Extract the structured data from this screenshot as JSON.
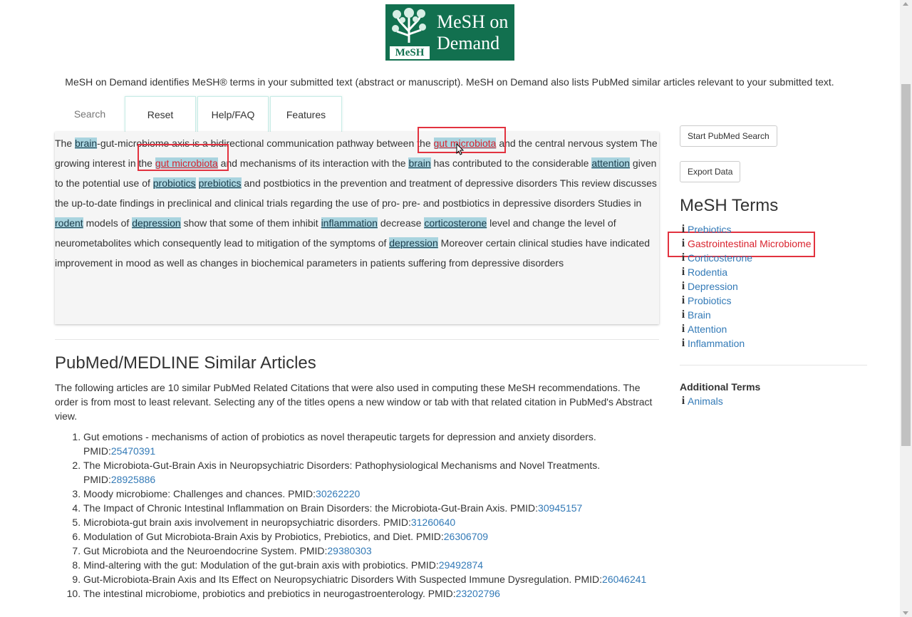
{
  "logo": {
    "line1": "MeSH on",
    "line2": "Demand",
    "tag": "MeSH"
  },
  "intro": "MeSH on Demand identifies MeSH® terms in your submitted text (abstract or manuscript). MeSH on Demand also lists PubMed similar articles relevant to your submitted text.",
  "tabs": {
    "search": "Search",
    "reset": "Reset",
    "help": "Help/FAQ",
    "features": "Features"
  },
  "text": {
    "t0": "The ",
    "h_brain1": "brain",
    "t1": "-gut-microbiome axis is a bidirectional communication pathway between the ",
    "h_gut1": "gut microbiota",
    "t2": " and the central nervous system The growing interest in the ",
    "h_gut2": "gut microbiota",
    "t3": " and mechanisms of its interaction with the ",
    "h_brain2": "brain",
    "t4": " has contributed to the considerable ",
    "h_attention": "attention",
    "t5": " given to the potential use of ",
    "h_probiotics": "probiotics",
    "t6": " ",
    "h_prebiotics": "prebiotics",
    "t7": " and postbiotics in the prevention and treatment of depressive disorders This review discusses the up-to-date findings in preclinical and clinical trials regarding the use of pro- pre- and postbiotics in depressive disorders Studies in ",
    "h_rodent": "rodent",
    "t8": " models of ",
    "h_depression1": "depression",
    "t9": " show that some of them inhibit ",
    "h_inflammation": "inflammation",
    "t10": " decrease ",
    "h_corticosterone": "corticosterone",
    "t11": " level and change the level of neurometabolites which consequently lead to mitigation of the symptoms of ",
    "h_depression2": "depression",
    "t12": " Moreover certain clinical studies have indicated improvement in mood as well as changes in biochemical parameters in patients suffering from depressive disorders"
  },
  "similar": {
    "title": "PubMed/MEDLINE Similar Articles",
    "description": "The following articles are 10 similar PubMed Related Citations that were also used in computing these MeSH recommendations. The order is from most to least relevant. Selecting any of the titles opens a new window or tab with that related citation in PubMed's Abstract view.",
    "pmid_label": "PMID:",
    "articles": [
      {
        "title": "Gut emotions - mechanisms of action of probiotics as novel therapeutic targets for depression and anxiety disorders.",
        "pmid": "25470391"
      },
      {
        "title": "The Microbiota-Gut-Brain Axis in Neuropsychiatric Disorders: Pathophysiological Mechanisms and Novel Treatments.",
        "pmid": "28925886"
      },
      {
        "title": "Moody microbiome: Challenges and chances.",
        "pmid": "30262220"
      },
      {
        "title": "The Impact of Chronic Intestinal Inflammation on Brain Disorders: the Microbiota-Gut-Brain Axis.",
        "pmid": "30945157"
      },
      {
        "title": "Microbiota-gut brain axis involvement in neuropsychiatric disorders.",
        "pmid": "31260640"
      },
      {
        "title": "Modulation of Gut Microbiota-Brain Axis by Probiotics, Prebiotics, and Diet.",
        "pmid": "26306709"
      },
      {
        "title": "Gut Microbiota and the Neuroendocrine System.",
        "pmid": "29380303"
      },
      {
        "title": "Mind-altering with the gut: Modulation of the gut-brain axis with probiotics.",
        "pmid": "29492874"
      },
      {
        "title": "Gut-Microbiota-Brain Axis and Its Effect on Neuropsychiatric Disorders With Suspected Immune Dysregulation.",
        "pmid": "26046241"
      },
      {
        "title": "The intestinal microbiome, probiotics and prebiotics in neurogastroenterology.",
        "pmid": "23202796"
      }
    ]
  },
  "sidebar": {
    "start_pubmed": "Start PubMed Search",
    "export": "Export Data",
    "mesh_title": "MeSH Terms",
    "terms": [
      "Prebiotics",
      "Gastrointestinal Microbiome",
      "Corticosterone",
      "Rodentia",
      "Depression",
      "Probiotics",
      "Brain",
      "Attention",
      "Inflammation"
    ],
    "additional_title": "Additional Terms",
    "additional": [
      "Animals"
    ]
  },
  "colors": {
    "brand": "#12704f",
    "highlight": "#a9d4df",
    "annotation": "#e2323f",
    "link": "#337ab7"
  }
}
